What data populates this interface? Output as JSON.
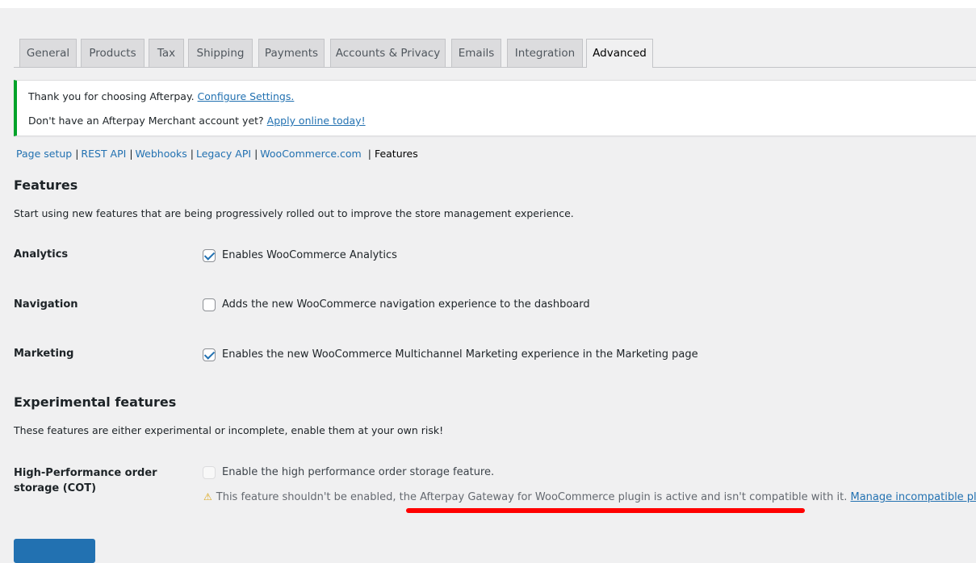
{
  "tabs": [
    {
      "label": "General"
    },
    {
      "label": "Products"
    },
    {
      "label": "Tax"
    },
    {
      "label": "Shipping"
    },
    {
      "label": "Payments"
    },
    {
      "label": "Accounts & Privacy"
    },
    {
      "label": "Emails"
    },
    {
      "label": "Integration"
    },
    {
      "label": "Advanced",
      "active": true
    }
  ],
  "notice": {
    "line1_text": "Thank you for choosing Afterpay.",
    "line1_link": "Configure Settings.",
    "line2_text": "Don't have an Afterpay Merchant account yet?",
    "line2_link": "Apply online today!",
    "border_color": "#00a32a"
  },
  "subnav": {
    "items": [
      "Page setup",
      "REST API",
      "Webhooks",
      "Legacy API",
      "WooCommerce.com",
      "Features"
    ],
    "separator": "|",
    "current": "Features"
  },
  "features": {
    "title": "Features",
    "description": "Start using new features that are being progressively rolled out to improve the store management experience.",
    "rows": [
      {
        "label": "Analytics",
        "checked": true,
        "text": "Enables WooCommerce Analytics"
      },
      {
        "label": "Navigation",
        "checked": false,
        "text": "Adds the new WooCommerce navigation experience to the dashboard"
      },
      {
        "label": "Marketing",
        "checked": true,
        "text": "Enables the new WooCommerce Multichannel Marketing experience in the Marketing page"
      }
    ]
  },
  "experimental": {
    "title": "Experimental features",
    "description": "These features are either experimental or incomplete, enable them at your own risk!",
    "row": {
      "label_line1": "High-Performance order",
      "label_line2": "storage (COT)",
      "checked": false,
      "disabled": true,
      "text": "Enable the high performance order storage feature.",
      "warning_icon": "warning-icon",
      "warning_text": "This feature shouldn't be enabled, the Afterpay Gateway for WooCommerce plugin is active and isn't compatible with it.",
      "warning_link": "Manage incompatible plugins"
    }
  },
  "colors": {
    "link": "#2271b1",
    "accent": "#2271b1",
    "highlight_underline": "#ff0000",
    "background": "#f0f0f1"
  }
}
